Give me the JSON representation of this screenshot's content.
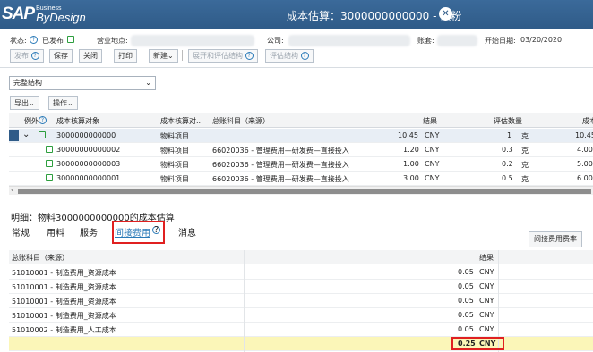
{
  "header": {
    "logo": {
      "brand": "SAP",
      "line1": "Business",
      "line2": "ByDesign"
    },
    "title": "成本估算：3000000000000 - 碳粉"
  },
  "status": {
    "status_label": "状态:",
    "status_value": "已发布",
    "site_label": "营业地点:",
    "company_label": "公司:",
    "account_label": "账套:",
    "start_date_label": "开始日期:",
    "start_date_value": "03/20/2020"
  },
  "toolbar": {
    "release": "发布",
    "save": "保存",
    "close": "关闭",
    "print": "打印",
    "new": "新建",
    "expand_eval": "展开和评估结构",
    "eval_struct": "评估结构"
  },
  "structure_select": {
    "value": "完整结构"
  },
  "grid_toolbar": {
    "export": "导出",
    "actions": "操作"
  },
  "grid": {
    "headers": {
      "exception": "例外",
      "object": "成本核算对象",
      "object_type": "成本核算对...",
      "gl_account": "总账科目（来源）",
      "result": "结果",
      "eval_qty": "评估数量",
      "cost_trunc": "成本"
    },
    "rows": [
      {
        "expand": "⌄",
        "object": "3000000000000",
        "type": "物料项目",
        "gl": "",
        "amount": "10.45",
        "cur": "CNY",
        "qty": "1",
        "unit": "克",
        "cost": "10.45"
      },
      {
        "object": "30000000000002",
        "type": "物料项目",
        "gl": "66020036 - 管理费用—研发费—直接投入",
        "amount": "1.20",
        "cur": "CNY",
        "qty": "0.3",
        "unit": "克",
        "cost": "4.00"
      },
      {
        "object": "30000000000003",
        "type": "物料项目",
        "gl": "66020036 - 管理费用—研发费—直接投入",
        "amount": "1.00",
        "cur": "CNY",
        "qty": "0.2",
        "unit": "克",
        "cost": "5.00"
      },
      {
        "object": "30000000000001",
        "type": "物料项目",
        "gl": "66020036 - 管理费用—研发费—直接投入",
        "amount": "3.00",
        "cur": "CNY",
        "qty": "0.5",
        "unit": "克",
        "cost": "6.00"
      }
    ]
  },
  "detail": {
    "title": "明细：物料3000000000000的成本估算",
    "tabs": [
      "常规",
      "用料",
      "服务",
      "间接费用",
      "消息"
    ],
    "rate_button": "间接费用费率",
    "headers": {
      "gl_account": "总账科目（来源）",
      "result": "结果"
    },
    "rows": [
      {
        "gl": "51010001 - 制造费用_资源成本",
        "amount": "0.05",
        "cur": "CNY"
      },
      {
        "gl": "51010001 - 制造费用_资源成本",
        "amount": "0.05",
        "cur": "CNY"
      },
      {
        "gl": "51010001 - 制造费用_资源成本",
        "amount": "0.05",
        "cur": "CNY"
      },
      {
        "gl": "51010001 - 制造费用_资源成本",
        "amount": "0.05",
        "cur": "CNY"
      },
      {
        "gl": "51010002 - 制造费用_人工成本",
        "amount": "0.05",
        "cur": "CNY"
      }
    ],
    "total": {
      "amount": "0.25",
      "cur": "CNY"
    }
  }
}
